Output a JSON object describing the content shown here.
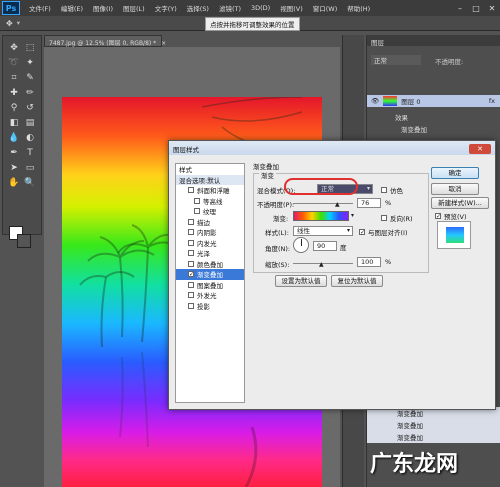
{
  "app": {
    "logo": "Ps"
  },
  "menu": [
    "文件(F)",
    "编辑(E)",
    "图像(I)",
    "图层(L)",
    "文字(Y)",
    "选择(S)",
    "滤镜(T)",
    "3D(D)",
    "视图(V)",
    "窗口(W)",
    "帮助(H)"
  ],
  "window_controls": {
    "minimize": "–",
    "restore": "□",
    "close": "✕"
  },
  "options_bar": {
    "tooltip": "点按并拖移可调整效果的位置"
  },
  "document": {
    "tab_title": "7487.jpg @ 12.5% (图层 0, RGB/8) *",
    "tab_close": "×"
  },
  "layers_panel": {
    "title": "图层",
    "blend_mode": "正常",
    "opacity_label": "不透明度:",
    "layers": [
      {
        "name": "图层 0",
        "fx": "fx"
      },
      {
        "name": "效果"
      },
      {
        "name": "渐变叠加"
      }
    ],
    "bottom_rows": [
      {
        "name": "渐变叠加"
      },
      {
        "name": "渐变叠加"
      },
      {
        "name": "渐变叠加"
      }
    ]
  },
  "dialog": {
    "title": "图层样式",
    "close": "✕",
    "style_list": {
      "header": "样式",
      "blending_options": "混合选项:默认",
      "items": [
        {
          "label": "斜面和浮雕",
          "checked": false,
          "sub": false
        },
        {
          "label": "等高线",
          "checked": false,
          "sub": true
        },
        {
          "label": "纹理",
          "checked": false,
          "sub": true
        },
        {
          "label": "描边",
          "checked": false,
          "sub": false
        },
        {
          "label": "内阴影",
          "checked": false,
          "sub": false
        },
        {
          "label": "内发光",
          "checked": false,
          "sub": false
        },
        {
          "label": "光泽",
          "checked": false,
          "sub": false
        },
        {
          "label": "颜色叠加",
          "checked": false,
          "sub": false
        },
        {
          "label": "渐变叠加",
          "checked": true,
          "sub": false,
          "active": true
        },
        {
          "label": "图案叠加",
          "checked": false,
          "sub": false
        },
        {
          "label": "外发光",
          "checked": false,
          "sub": false
        },
        {
          "label": "投影",
          "checked": false,
          "sub": false
        }
      ]
    },
    "section_title": "渐变叠加",
    "group_title": "渐变",
    "blend_mode_label": "混合模式(O):",
    "blend_mode_value": "正常",
    "dither_label": "仿色",
    "opacity_label": "不透明度(P):",
    "opacity_value": "76",
    "percent": "%",
    "gradient_label": "渐变:",
    "reverse_label": "反向(R)",
    "style_label": "样式(L):",
    "style_value": "线性",
    "align_label": "与图层对齐(I)",
    "angle_label": "角度(N):",
    "angle_value": "90",
    "degree": "度",
    "scale_label": "缩放(S):",
    "scale_value": "100",
    "default_btn": "设置为默认值",
    "reset_btn": "复位为默认值",
    "ok": "确定",
    "cancel": "取消",
    "new_style": "新建样式(W)...",
    "preview_label": "预览(V)"
  },
  "watermark": "广东龙网"
}
